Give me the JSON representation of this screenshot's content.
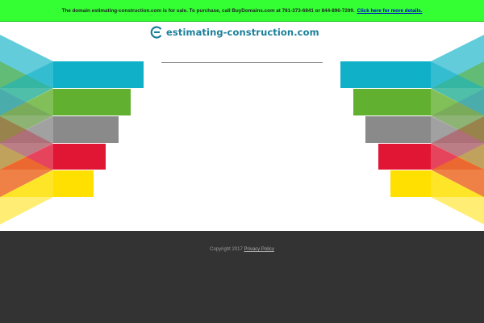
{
  "banner": {
    "text": "The domain estimating-construction.com is for sale. To purchase, call BuyDomains.com at 781-373-6841 or 844-896-7299.",
    "link": "Click here for more details."
  },
  "header": {
    "site_name": "estimating-construction.com"
  },
  "footer": {
    "copyright": "Copyright 2017",
    "privacy_link": "Privacy Policy"
  },
  "colors": {
    "banner_bg": "#33ff33",
    "brand": "#1a7f9a",
    "footer_bg": "#333333",
    "bars": [
      "#0fb0c8",
      "#62b030",
      "#8a8a8a",
      "#e01634",
      "#ffe000"
    ]
  }
}
